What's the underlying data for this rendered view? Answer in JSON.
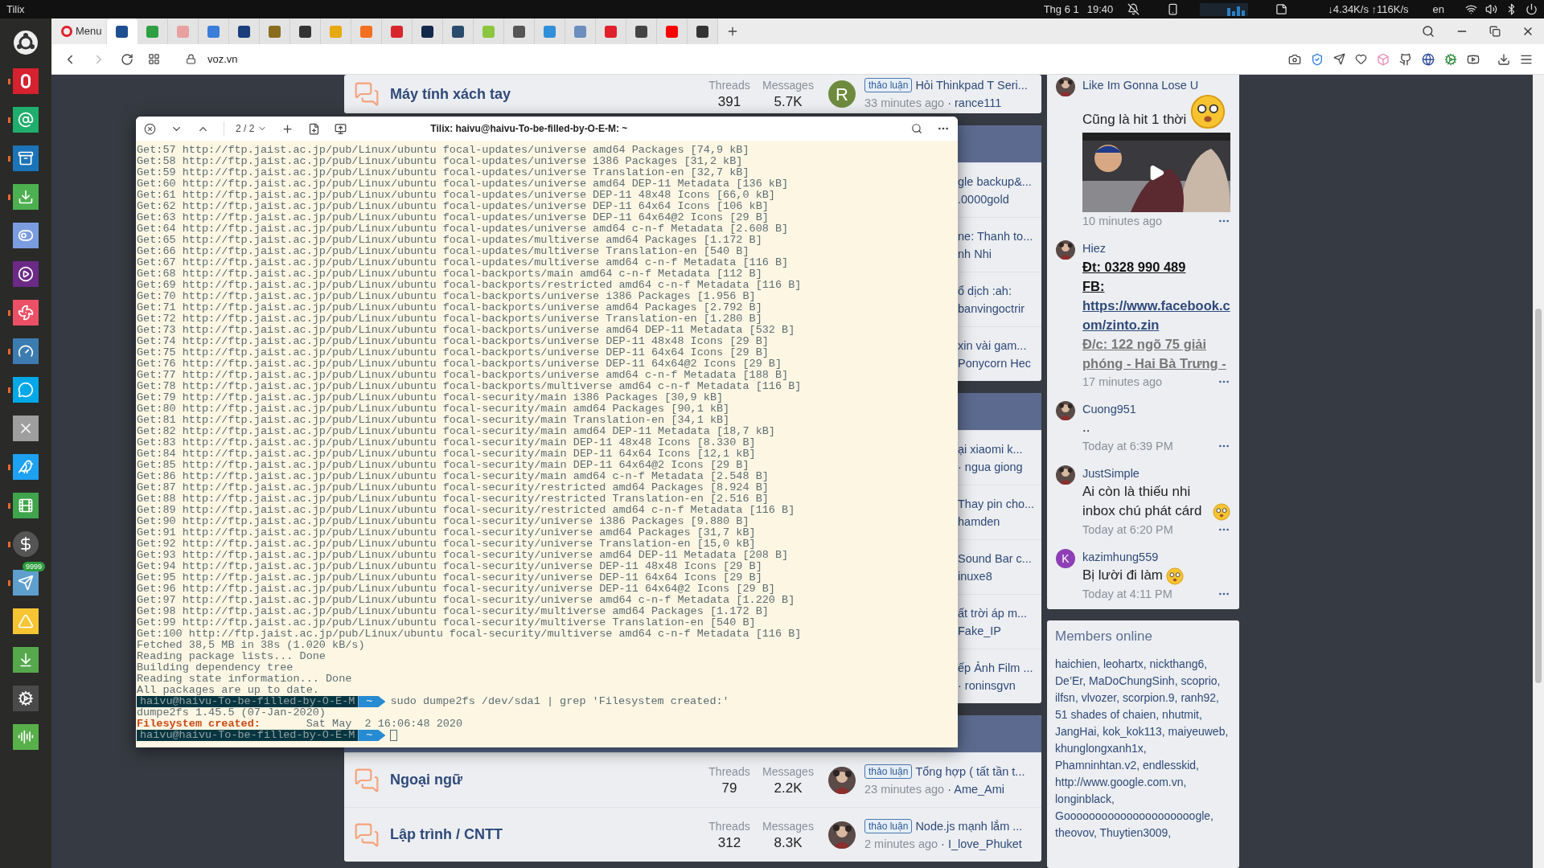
{
  "top_panel": {
    "app_name": "Tilix",
    "date": "Thg 6 1",
    "time": "19:40",
    "net_speed": "↓4.34K/s ↑116K/s",
    "language": "en"
  },
  "dock": [
    {
      "running": false
    },
    {
      "running": true
    },
    {
      "running": true
    },
    {
      "running": true
    },
    {
      "running": true
    },
    {
      "running": false
    },
    {
      "running": false
    },
    {
      "running": true
    },
    {
      "running": true
    },
    {
      "running": true
    },
    {
      "running": false
    },
    {
      "running": true
    },
    {
      "running": true
    },
    {
      "running": true
    },
    {
      "running": true,
      "badge": "9999"
    },
    {
      "running": false
    },
    {
      "running": false
    },
    {
      "running": false
    },
    {
      "running": false
    }
  ],
  "browser": {
    "menu_label": "Menu",
    "url": "voz.vn",
    "tabs": [
      {
        "selected": true
      },
      {
        "selected": false
      },
      {
        "selected": false
      },
      {
        "selected": false
      },
      {
        "selected": false
      },
      {
        "selected": false
      },
      {
        "selected": false
      },
      {
        "selected": false
      },
      {
        "selected": false
      },
      {
        "selected": false
      },
      {
        "selected": false
      },
      {
        "selected": false
      },
      {
        "selected": false
      },
      {
        "selected": false
      },
      {
        "selected": false
      },
      {
        "selected": false
      },
      {
        "selected": false
      },
      {
        "selected": false
      },
      {
        "selected": false
      },
      {
        "selected": false
      }
    ]
  },
  "forum": {
    "cards": [
      {
        "header": false,
        "rows": [
          {
            "kind": "full",
            "title": "Máy tính xách tay",
            "threads_label": "Threads",
            "threads": "391",
            "messages_label": "Messages",
            "messages": "5.7K",
            "avatar": {
              "kind": "letter",
              "letter": "R",
              "color": "#6e8b3d"
            },
            "tag": "thảo luận",
            "latest": "Hỏi Thinkpad T Seri...",
            "time": "33 minutes ago",
            "author": "· rance111"
          }
        ]
      },
      {
        "header": true,
        "rows": [
          {
            "kind": "partial",
            "latest": "gle backup&...",
            "meta": ".0000gold"
          },
          {
            "kind": "partial",
            "latest": "ne: Thanh to...",
            "meta": "nh Nhi"
          },
          {
            "kind": "partial",
            "latest": "ổ dịch :ah:",
            "meta": "banvingoctrir"
          },
          {
            "kind": "partial",
            "latest": "xin vài gam...",
            "meta": "Ponycorn Hec"
          }
        ]
      },
      {
        "header": true,
        "rows": [
          {
            "kind": "partial",
            "latest": "ại xiaomi k...",
            "meta": "· ngua giong"
          },
          {
            "kind": "partial",
            "latest": "Thay pin cho...",
            "meta": "hamden"
          },
          {
            "kind": "partial",
            "latest": "Sound Bar c...",
            "meta": "inuxe8"
          },
          {
            "kind": "partial",
            "latest": "ất trời áp m...",
            "meta": "Fake_IP"
          },
          {
            "kind": "partial",
            "latest": "ếp Ảnh Film ...",
            "meta": "· roninsgvn"
          }
        ]
      },
      {
        "header": true,
        "rows": [
          {
            "kind": "full",
            "title": "Ngoại ngữ",
            "threads_label": "Threads",
            "threads": "79",
            "messages_label": "Messages",
            "messages": "2.2K",
            "avatar": {
              "kind": "picture"
            },
            "tag": "thảo luận",
            "latest": "Tổng hợp ( tất tần t...",
            "time": "23 minutes ago",
            "author": "· Ame_Ami"
          },
          {
            "kind": "full",
            "title": "Lập trình / CNTT",
            "threads_label": "Threads",
            "threads": "312",
            "messages_label": "Messages",
            "messages": "8.3K",
            "avatar": {
              "kind": "picture"
            },
            "tag": "thảo luận",
            "latest": "Node.js mạnh lắm ...",
            "time": "2 minutes ago",
            "author": "· I_love_Phuket"
          }
        ]
      }
    ]
  },
  "activity": [
    {
      "user": "Like Im Gonna Lose U",
      "avatar": {
        "kind": "picture"
      },
      "blocks": [
        {
          "kind": "text",
          "text": "Cũng là hit 1 thời",
          "emoji": true
        },
        {
          "kind": "video"
        }
      ],
      "time": "10 minutes ago"
    },
    {
      "user": "Hiez",
      "avatar": {
        "kind": "picture"
      },
      "blocks": [
        {
          "kind": "strong",
          "text": "Đt: 0328 990 489"
        },
        {
          "kind": "strong",
          "text": "FB:"
        },
        {
          "kind": "link",
          "text": "https://www.facebook.com/zinto.zin"
        },
        {
          "kind": "faded",
          "text": "Đ/c: 122 ngõ 75 giải phóng - Hai Bà Trưng -"
        }
      ],
      "time": "17 minutes ago"
    },
    {
      "user": "Cuong951",
      "avatar": {
        "kind": "picture"
      },
      "blocks": [
        {
          "kind": "text",
          "text": "..",
          "emoji": false
        }
      ],
      "time": "Today at 6:39 PM"
    },
    {
      "user": "JustSimple",
      "avatar": {
        "kind": "picture"
      },
      "blocks": [
        {
          "kind": "text",
          "text": "Ai còn là thiếu nhi inbox chú phát cárd",
          "emoji": true
        }
      ],
      "time": "Today at 6:20 PM"
    },
    {
      "user": "kazimhung559",
      "avatar": {
        "kind": "letter",
        "letter": "K",
        "color": "#8e3fb5"
      },
      "blocks": [
        {
          "kind": "text",
          "text": "Bị lười đi làm",
          "emoji": true
        }
      ],
      "time": "Today at 4:11 PM"
    }
  ],
  "members": {
    "title": "Members online",
    "names": "haichien, leohartx, nickthang6, De’Er, MaDoChungSinh, scoprio, ilfsn, vlvozer, scorpion.9, ranh92, 51 shades of chaien, nhutmit, JangHai, kok_kok113, maiyeuweb, khunglongxanh1x, Phamninhtan.v2, endlesskid, http://www.google.com.vn, longinblack, Gooooooooooooooooooooogle, theovov, Thuytien3009,"
  },
  "terminal": {
    "title": "Tilix: haivu@haivu-To-be-filled-by-O-E-M: ~",
    "session": "2 / 2",
    "lines": [
      {
        "kind": "output",
        "text": "Get:57 http://ftp.jaist.ac.jp/pub/Linux/ubuntu focal-updates/universe amd64 Packages [74,9 kB]"
      },
      {
        "kind": "output",
        "text": "Get:58 http://ftp.jaist.ac.jp/pub/Linux/ubuntu focal-updates/universe i386 Packages [31,2 kB]"
      },
      {
        "kind": "output",
        "text": "Get:59 http://ftp.jaist.ac.jp/pub/Linux/ubuntu focal-updates/universe Translation-en [32,7 kB]"
      },
      {
        "kind": "output",
        "text": "Get:60 http://ftp.jaist.ac.jp/pub/Linux/ubuntu focal-updates/universe amd64 DEP-11 Metadata [136 kB]"
      },
      {
        "kind": "output",
        "text": "Get:61 http://ftp.jaist.ac.jp/pub/Linux/ubuntu focal-updates/universe DEP-11 48x48 Icons [66,0 kB]"
      },
      {
        "kind": "output",
        "text": "Get:62 http://ftp.jaist.ac.jp/pub/Linux/ubuntu focal-updates/universe DEP-11 64x64 Icons [106 kB]"
      },
      {
        "kind": "output",
        "text": "Get:63 http://ftp.jaist.ac.jp/pub/Linux/ubuntu focal-updates/universe DEP-11 64x64@2 Icons [29 B]"
      },
      {
        "kind": "output",
        "text": "Get:64 http://ftp.jaist.ac.jp/pub/Linux/ubuntu focal-updates/universe amd64 c-n-f Metadata [2.608 B]"
      },
      {
        "kind": "output",
        "text": "Get:65 http://ftp.jaist.ac.jp/pub/Linux/ubuntu focal-updates/multiverse amd64 Packages [1.172 B]"
      },
      {
        "kind": "output",
        "text": "Get:66 http://ftp.jaist.ac.jp/pub/Linux/ubuntu focal-updates/multiverse Translation-en [540 B]"
      },
      {
        "kind": "output",
        "text": "Get:67 http://ftp.jaist.ac.jp/pub/Linux/ubuntu focal-updates/multiverse amd64 c-n-f Metadata [116 B]"
      },
      {
        "kind": "output",
        "text": "Get:68 http://ftp.jaist.ac.jp/pub/Linux/ubuntu focal-backports/main amd64 c-n-f Metadata [112 B]"
      },
      {
        "kind": "output",
        "text": "Get:69 http://ftp.jaist.ac.jp/pub/Linux/ubuntu focal-backports/restricted amd64 c-n-f Metadata [116 B]"
      },
      {
        "kind": "output",
        "text": "Get:70 http://ftp.jaist.ac.jp/pub/Linux/ubuntu focal-backports/universe i386 Packages [1.956 B]"
      },
      {
        "kind": "output",
        "text": "Get:71 http://ftp.jaist.ac.jp/pub/Linux/ubuntu focal-backports/universe amd64 Packages [2.792 B]"
      },
      {
        "kind": "output",
        "text": "Get:72 http://ftp.jaist.ac.jp/pub/Linux/ubuntu focal-backports/universe Translation-en [1.280 B]"
      },
      {
        "kind": "output",
        "text": "Get:73 http://ftp.jaist.ac.jp/pub/Linux/ubuntu focal-backports/universe amd64 DEP-11 Metadata [532 B]"
      },
      {
        "kind": "output",
        "text": "Get:74 http://ftp.jaist.ac.jp/pub/Linux/ubuntu focal-backports/universe DEP-11 48x48 Icons [29 B]"
      },
      {
        "kind": "output",
        "text": "Get:75 http://ftp.jaist.ac.jp/pub/Linux/ubuntu focal-backports/universe DEP-11 64x64 Icons [29 B]"
      },
      {
        "kind": "output",
        "text": "Get:76 http://ftp.jaist.ac.jp/pub/Linux/ubuntu focal-backports/universe DEP-11 64x64@2 Icons [29 B]"
      },
      {
        "kind": "output",
        "text": "Get:77 http://ftp.jaist.ac.jp/pub/Linux/ubuntu focal-backports/universe amd64 c-n-f Metadata [188 B]"
      },
      {
        "kind": "output",
        "text": "Get:78 http://ftp.jaist.ac.jp/pub/Linux/ubuntu focal-backports/multiverse amd64 c-n-f Metadata [116 B]"
      },
      {
        "kind": "output",
        "text": "Get:79 http://ftp.jaist.ac.jp/pub/Linux/ubuntu focal-security/main i386 Packages [30,9 kB]"
      },
      {
        "kind": "output",
        "text": "Get:80 http://ftp.jaist.ac.jp/pub/Linux/ubuntu focal-security/main amd64 Packages [90,1 kB]"
      },
      {
        "kind": "output",
        "text": "Get:81 http://ftp.jaist.ac.jp/pub/Linux/ubuntu focal-security/main Translation-en [34,1 kB]"
      },
      {
        "kind": "output",
        "text": "Get:82 http://ftp.jaist.ac.jp/pub/Linux/ubuntu focal-security/main amd64 DEP-11 Metadata [18,7 kB]"
      },
      {
        "kind": "output",
        "text": "Get:83 http://ftp.jaist.ac.jp/pub/Linux/ubuntu focal-security/main DEP-11 48x48 Icons [8.330 B]"
      },
      {
        "kind": "output",
        "text": "Get:84 http://ftp.jaist.ac.jp/pub/Linux/ubuntu focal-security/main DEP-11 64x64 Icons [12,1 kB]"
      },
      {
        "kind": "output",
        "text": "Get:85 http://ftp.jaist.ac.jp/pub/Linux/ubuntu focal-security/main DEP-11 64x64@2 Icons [29 B]"
      },
      {
        "kind": "output",
        "text": "Get:86 http://ftp.jaist.ac.jp/pub/Linux/ubuntu focal-security/main amd64 c-n-f Metadata [2.548 B]"
      },
      {
        "kind": "output",
        "text": "Get:87 http://ftp.jaist.ac.jp/pub/Linux/ubuntu focal-security/restricted amd64 Packages [8.924 B]"
      },
      {
        "kind": "output",
        "text": "Get:88 http://ftp.jaist.ac.jp/pub/Linux/ubuntu focal-security/restricted Translation-en [2.516 B]"
      },
      {
        "kind": "output",
        "text": "Get:89 http://ftp.jaist.ac.jp/pub/Linux/ubuntu focal-security/restricted amd64 c-n-f Metadata [116 B]"
      },
      {
        "kind": "output",
        "text": "Get:90 http://ftp.jaist.ac.jp/pub/Linux/ubuntu focal-security/universe i386 Packages [9.880 B]"
      },
      {
        "kind": "output",
        "text": "Get:91 http://ftp.jaist.ac.jp/pub/Linux/ubuntu focal-security/universe amd64 Packages [31,7 kB]"
      },
      {
        "kind": "output",
        "text": "Get:92 http://ftp.jaist.ac.jp/pub/Linux/ubuntu focal-security/universe Translation-en [15,0 kB]"
      },
      {
        "kind": "output",
        "text": "Get:93 http://ftp.jaist.ac.jp/pub/Linux/ubuntu focal-security/universe amd64 DEP-11 Metadata [208 B]"
      },
      {
        "kind": "output",
        "text": "Get:94 http://ftp.jaist.ac.jp/pub/Linux/ubuntu focal-security/universe DEP-11 48x48 Icons [29 B]"
      },
      {
        "kind": "output",
        "text": "Get:95 http://ftp.jaist.ac.jp/pub/Linux/ubuntu focal-security/universe DEP-11 64x64 Icons [29 B]"
      },
      {
        "kind": "output",
        "text": "Get:96 http://ftp.jaist.ac.jp/pub/Linux/ubuntu focal-security/universe DEP-11 64x64@2 Icons [29 B]"
      },
      {
        "kind": "output",
        "text": "Get:97 http://ftp.jaist.ac.jp/pub/Linux/ubuntu focal-security/universe amd64 c-n-f Metadata [1.220 B]"
      },
      {
        "kind": "output",
        "text": "Get:98 http://ftp.jaist.ac.jp/pub/Linux/ubuntu focal-security/multiverse amd64 Packages [1.172 B]"
      },
      {
        "kind": "output",
        "text": "Get:99 http://ftp.jaist.ac.jp/pub/Linux/ubuntu focal-security/multiverse Translation-en [540 B]"
      },
      {
        "kind": "output",
        "text": "Get:100 http://ftp.jaist.ac.jp/pub/Linux/ubuntu focal-security/multiverse amd64 c-n-f Metadata [116 B]"
      },
      {
        "kind": "output",
        "text": "Fetched 38,5 MB in 38s (1.020 kB/s)"
      },
      {
        "kind": "output",
        "text": "Reading package lists... Done"
      },
      {
        "kind": "output",
        "text": "Building dependency tree"
      },
      {
        "kind": "output",
        "text": "Reading state information... Done"
      },
      {
        "kind": "output",
        "text": "All packages are up to date."
      },
      {
        "kind": "prompt",
        "user": "haivu@haivu-To-be-filled-by-O-E-M",
        "dir": "~",
        "command": "sudo dumpe2fs /dev/sda1 | grep 'Filesystem created:'",
        "cursor": false
      },
      {
        "kind": "output",
        "text": "dumpe2fs 1.45.5 (07-Jan-2020)"
      },
      {
        "kind": "field",
        "label": "Filesystem created:",
        "value": "Sat May  2 16:06:48 2020"
      },
      {
        "kind": "prompt",
        "user": "haivu@haivu-To-be-filled-by-O-E-M",
        "dir": "~",
        "cursor": true
      }
    ]
  }
}
